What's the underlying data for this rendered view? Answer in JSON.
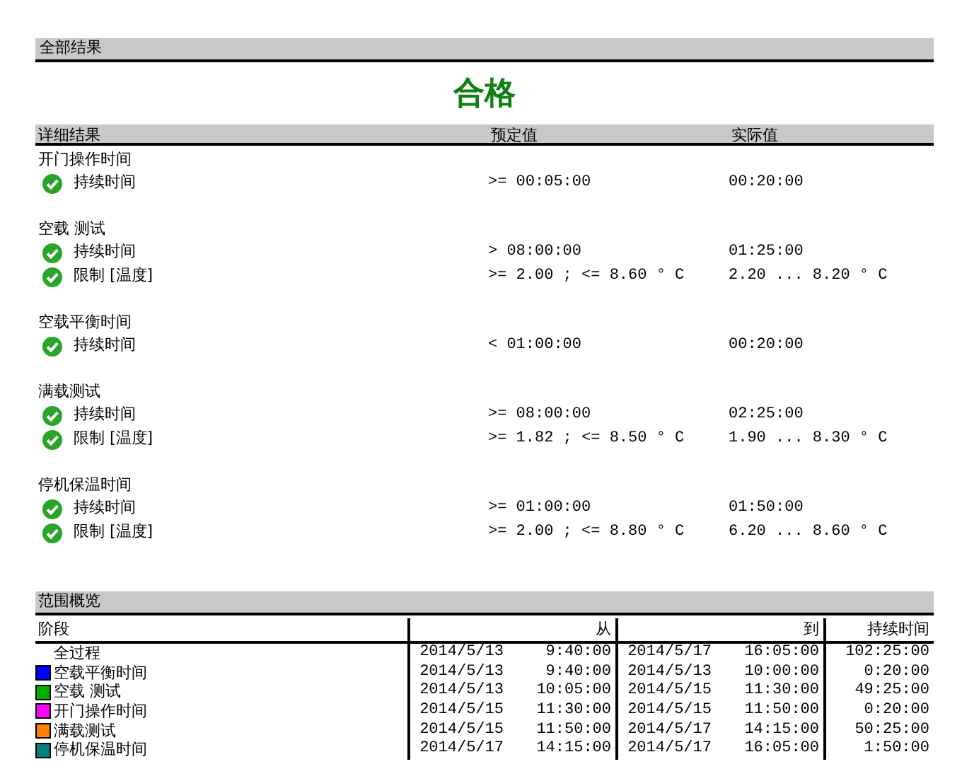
{
  "summary": {
    "heading": "全部结果",
    "result": "合格"
  },
  "details": {
    "columns": [
      "详细结果",
      "预定值",
      "实际值"
    ],
    "groups": [
      {
        "title": "开门操作时间",
        "items": [
          {
            "label": "持续时间",
            "passed": true,
            "expected": ">= 00:05:00",
            "actual": "00:20:00"
          }
        ]
      },
      {
        "title": "空载 测试",
        "items": [
          {
            "label": "持续时间",
            "passed": true,
            "expected": "> 08:00:00",
            "actual": "01:25:00"
          },
          {
            "label": "限制 [温度]",
            "passed": true,
            "expected": ">= 2.00 ; <= 8.60 ° C",
            "actual": "2.20 ... 8.20 ° C"
          }
        ]
      },
      {
        "title": "空载平衡时间",
        "items": [
          {
            "label": "持续时间",
            "passed": true,
            "expected": "< 01:00:00",
            "actual": "00:20:00"
          }
        ]
      },
      {
        "title": "满载测试",
        "items": [
          {
            "label": "持续时间",
            "passed": true,
            "expected": ">= 08:00:00",
            "actual": "02:25:00"
          },
          {
            "label": "限制 [温度]",
            "passed": true,
            "expected": ">= 1.82 ; <= 8.50 ° C",
            "actual": "1.90 ... 8.30 ° C"
          }
        ]
      },
      {
        "title": "停机保温时间",
        "items": [
          {
            "label": "持续时间",
            "passed": true,
            "expected": ">= 01:00:00",
            "actual": "01:50:00"
          },
          {
            "label": "限制 [温度]",
            "passed": true,
            "expected": ">= 2.00 ; <= 8.80 ° C",
            "actual": "6.20 ... 8.60 ° C"
          }
        ]
      }
    ]
  },
  "overview": {
    "heading": "范围概览",
    "columns": [
      "阶段",
      "从",
      "到",
      "持续时间"
    ],
    "rows": [
      {
        "phase": "全过程",
        "from_date": "2014/5/13",
        "from_time": "9:40:00",
        "to_date": "2014/5/17",
        "to_time": "16:05:00",
        "duration": "102:25:00"
      },
      {
        "phase": "空载平衡时间",
        "color": "#0000ff",
        "from_date": "2014/5/13",
        "from_time": "9:40:00",
        "to_date": "2014/5/13",
        "to_time": "10:00:00",
        "duration": "0:20:00"
      },
      {
        "phase": "空载 测试",
        "color": "#00b000",
        "from_date": "2014/5/13",
        "from_time": "10:05:00",
        "to_date": "2014/5/15",
        "to_time": "11:30:00",
        "duration": "49:25:00"
      },
      {
        "phase": "开门操作时间",
        "color": "#ff00ff",
        "from_date": "2014/5/15",
        "from_time": "11:30:00",
        "to_date": "2014/5/15",
        "to_time": "11:50:00",
        "duration": "0:20:00"
      },
      {
        "phase": "满载测试",
        "color": "#ff8000",
        "from_date": "2014/5/15",
        "from_time": "11:50:00",
        "to_date": "2014/5/17",
        "to_time": "14:15:00",
        "duration": "50:25:00"
      },
      {
        "phase": "停机保温时间",
        "color": "#008080",
        "from_date": "2014/5/17",
        "from_time": "14:15:00",
        "to_date": "2014/5/17",
        "to_time": "16:05:00",
        "duration": "1:50:00"
      }
    ]
  }
}
